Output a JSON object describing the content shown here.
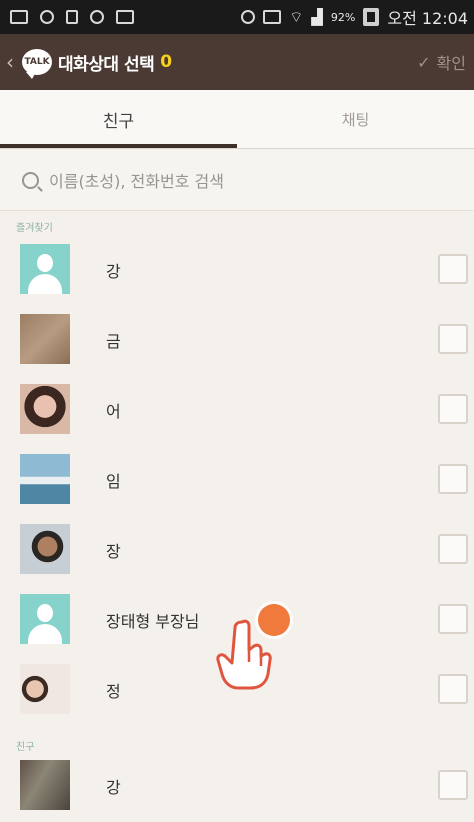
{
  "status_bar": {
    "battery_percent": "92%",
    "clock": "오전 12:04"
  },
  "header": {
    "back_symbol": "‹",
    "logo_text": "TALK",
    "title": "대화상대 선택",
    "count": "0",
    "confirm_label": "확인"
  },
  "tabs": [
    {
      "label": "친구"
    },
    {
      "label": "채팅"
    }
  ],
  "search": {
    "placeholder": "이름(초성), 전화번호 검색"
  },
  "sections": {
    "favorites": "즐겨찾기",
    "friends": "친구"
  },
  "contacts": [
    {
      "name": "강",
      "avatar": "default-person-icon"
    },
    {
      "name": "금",
      "avatar": "photo"
    },
    {
      "name": "어",
      "avatar": "photo"
    },
    {
      "name": "임",
      "avatar": "photo"
    },
    {
      "name": "장",
      "avatar": "photo"
    },
    {
      "name": "장태형 부장님",
      "avatar": "default-person-icon"
    },
    {
      "name": "정",
      "avatar": "photo"
    },
    {
      "name": "강",
      "avatar": "photo"
    }
  ],
  "colors": {
    "header_bg": "#4b3a33",
    "count_accent": "#f7d11c",
    "default_avatar": "#86d3cc",
    "tap_indicator": "#f07a3c"
  }
}
